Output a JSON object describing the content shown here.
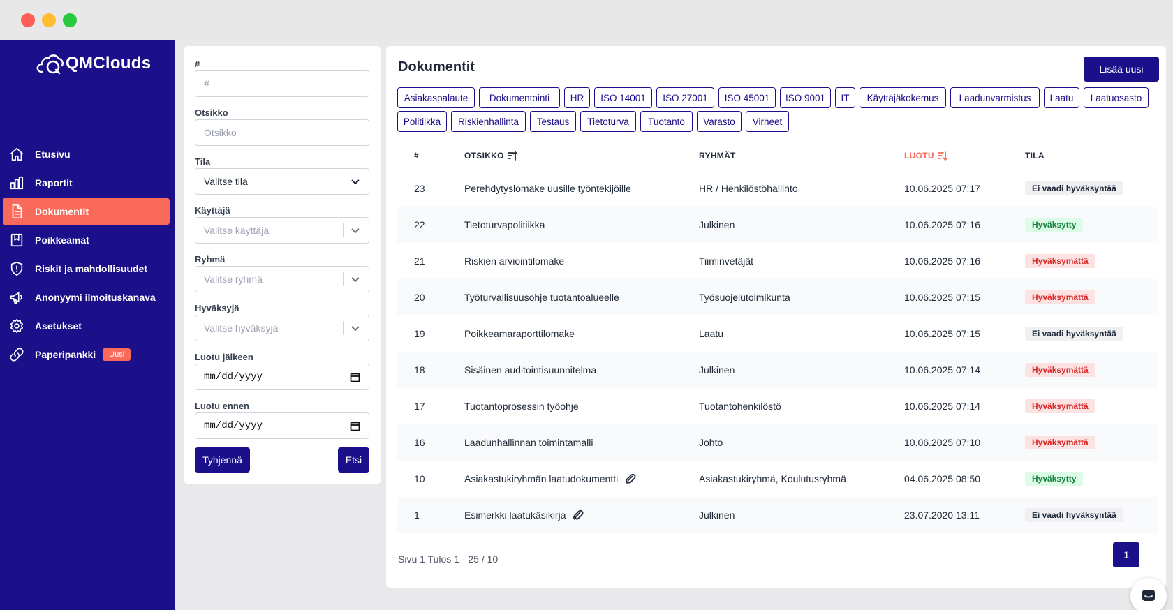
{
  "brand": {
    "name": "QMClouds"
  },
  "sidebar": {
    "items": [
      {
        "label": "Etusivu",
        "icon": "home-icon"
      },
      {
        "label": "Raportit",
        "icon": "bar-chart-icon"
      },
      {
        "label": "Dokumentit",
        "icon": "document-icon",
        "active": true
      },
      {
        "label": "Poikkeamat",
        "icon": "bookmark-icon"
      },
      {
        "label": "Riskit ja mahdollisuudet",
        "icon": "shield-alert-icon"
      },
      {
        "label": "Anonyymi ilmoituskanava",
        "icon": "megaphone-icon"
      },
      {
        "label": "Asetukset",
        "icon": "gear-icon"
      },
      {
        "label": "Paperipankki",
        "icon": "link-icon",
        "badge": "Uusi"
      }
    ]
  },
  "filters": {
    "id": {
      "label": "#",
      "placeholder": "#"
    },
    "title": {
      "label": "Otsikko",
      "placeholder": "Otsikko"
    },
    "status": {
      "label": "Tila",
      "value": "Valitse tila"
    },
    "user": {
      "label": "Käyttäjä",
      "placeholder": "Valitse käyttäjä"
    },
    "group": {
      "label": "Ryhmä",
      "placeholder": "Valitse ryhmä"
    },
    "approver": {
      "label": "Hyväksyjä",
      "placeholder": "Valitse hyväksyjä"
    },
    "created_after": {
      "label": "Luotu jälkeen",
      "value": "mm/dd/yyyy"
    },
    "created_before": {
      "label": "Luotu ennen",
      "value": "mm/dd/yyyy"
    },
    "clear_label": "Tyhjennä",
    "search_label": "Etsi"
  },
  "main": {
    "title": "Dokumentit",
    "add_label": "Lisää uusi",
    "tags": [
      "Asiakaspalaute",
      "Dokumentointi",
      "HR",
      "ISO 14001",
      "ISO 27001",
      "ISO 45001",
      "ISO 9001",
      "IT",
      "Käyttäjäkokemus",
      "Laadunvarmistus",
      "Laatu",
      "Laatuosasto",
      "Politiikka",
      "Riskienhallinta",
      "Testaus",
      "Tietoturva",
      "Tuotanto",
      "Varasto",
      "Virheet"
    ],
    "table": {
      "headers": {
        "id": "#",
        "title": "OTSIKKO",
        "groups": "RYHMÄT",
        "created": "LUOTU",
        "status": "TILA"
      },
      "rows": [
        {
          "id": "23",
          "title": "Perehdytyslomake uusille työntekijöille",
          "attachment": false,
          "groups": "HR / Henkilöstöhallinto",
          "created": "10.06.2025 07:17",
          "status": "Ei vaadi hyväksyntää",
          "status_type": "none"
        },
        {
          "id": "22",
          "title": "Tietoturvapolitiikka",
          "attachment": false,
          "groups": "Julkinen",
          "created": "10.06.2025 07:16",
          "status": "Hyväksytty",
          "status_type": "ok"
        },
        {
          "id": "21",
          "title": "Riskien arviointilomake",
          "attachment": false,
          "groups": "Tiiminvetäjät",
          "created": "10.06.2025 07:16",
          "status": "Hyväksymättä",
          "status_type": "rej"
        },
        {
          "id": "20",
          "title": "Työturvallisuusohje tuotantoalueelle",
          "attachment": false,
          "groups": "Työsuojelutoimikunta",
          "created": "10.06.2025 07:15",
          "status": "Hyväksymättä",
          "status_type": "rej"
        },
        {
          "id": "19",
          "title": "Poikkeamaraporttilomake",
          "attachment": false,
          "groups": "Laatu",
          "created": "10.06.2025 07:15",
          "status": "Ei vaadi hyväksyntää",
          "status_type": "none"
        },
        {
          "id": "18",
          "title": "Sisäinen auditointisuunnitelma",
          "attachment": false,
          "groups": "Julkinen",
          "created": "10.06.2025 07:14",
          "status": "Hyväksymättä",
          "status_type": "rej"
        },
        {
          "id": "17",
          "title": "Tuotantoprosessin työohje",
          "attachment": false,
          "groups": "Tuotantohenkilöstö",
          "created": "10.06.2025 07:14",
          "status": "Hyväksymättä",
          "status_type": "rej"
        },
        {
          "id": "16",
          "title": "Laadunhallinnan toimintamalli",
          "attachment": false,
          "groups": "Johto",
          "created": "10.06.2025 07:10",
          "status": "Hyväksymättä",
          "status_type": "rej"
        },
        {
          "id": "10",
          "title": "Asiakastukiryhmän laatudokumentti",
          "attachment": true,
          "groups": "Asiakastukiryhmä, Koulutusryhmä",
          "created": "04.06.2025 08:50",
          "status": "Hyväksytty",
          "status_type": "ok"
        },
        {
          "id": "1",
          "title": "Esimerkki laatukäsikirja",
          "attachment": true,
          "groups": "Julkinen",
          "created": "23.07.2020 13:11",
          "status": "Ei vaadi hyväksyntää",
          "status_type": "none"
        }
      ]
    },
    "pagination": {
      "summary": "Sivu 1 Tulos 1 - 25 / 10",
      "current_page": "1"
    }
  },
  "colors": {
    "brand": "#1c0f8a",
    "accent": "#fa6a5a"
  }
}
